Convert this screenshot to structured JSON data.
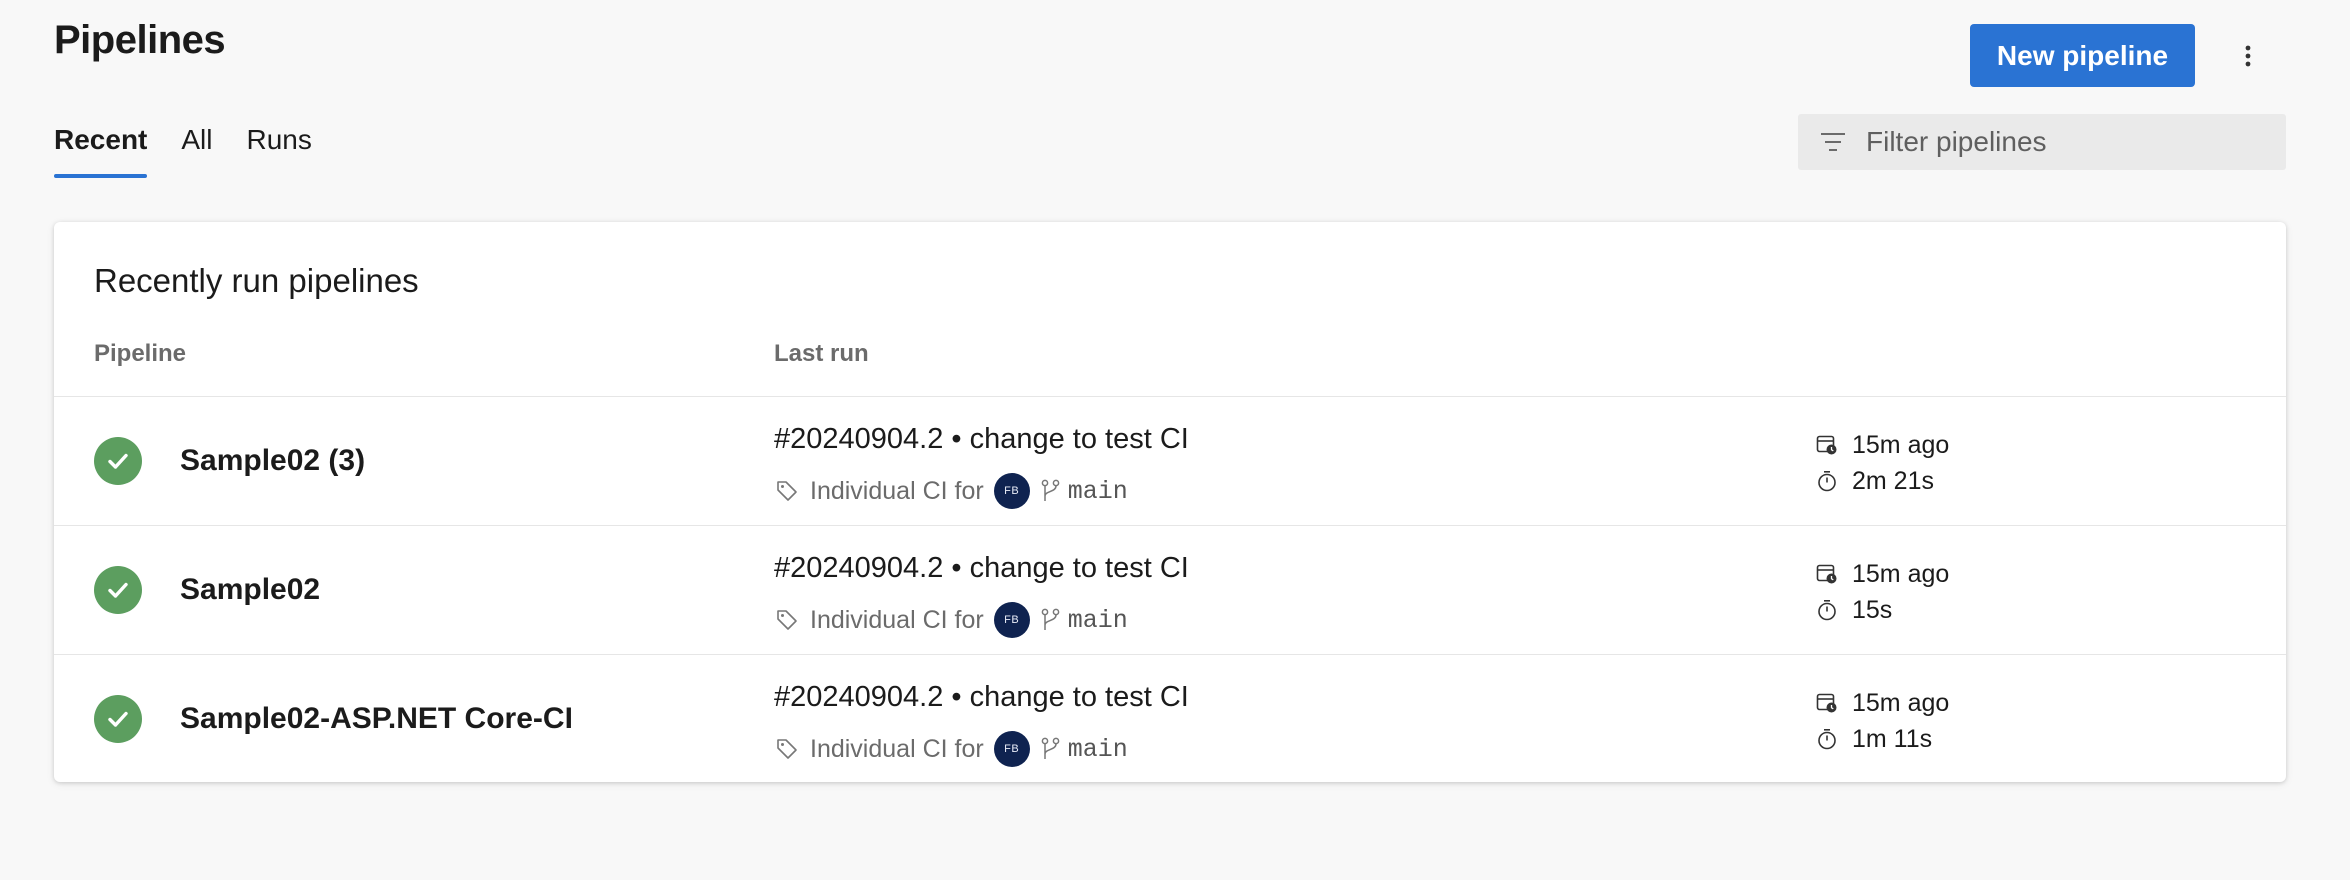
{
  "header": {
    "title": "Pipelines",
    "new_button": "New pipeline",
    "more_icon": "more-vertical-icon"
  },
  "tabs": [
    {
      "label": "Recent",
      "active": true
    },
    {
      "label": "All",
      "active": false
    },
    {
      "label": "Runs",
      "active": false
    }
  ],
  "filter": {
    "placeholder": "Filter pipelines",
    "value": "",
    "icon": "filter-icon"
  },
  "card": {
    "title": "Recently run pipelines",
    "columns": {
      "pipeline": "Pipeline",
      "last_run": "Last run"
    }
  },
  "rows": [
    {
      "name": "Sample02 (3)",
      "status": "succeeded",
      "status_color": "#5c9e5f",
      "run_title": "#20240904.2 • change to test CI",
      "trigger": "Individual CI for",
      "avatar_initials": "FB",
      "branch": "main",
      "started": "15m ago",
      "duration": "2m 21s"
    },
    {
      "name": "Sample02",
      "status": "succeeded",
      "status_color": "#5c9e5f",
      "run_title": "#20240904.2 • change to test CI",
      "trigger": "Individual CI for",
      "avatar_initials": "FB",
      "branch": "main",
      "started": "15m ago",
      "duration": "15s"
    },
    {
      "name": "Sample02-ASP.NET Core-CI",
      "status": "succeeded",
      "status_color": "#5c9e5f",
      "run_title": "#20240904.2 • change to test CI",
      "trigger": "Individual CI for",
      "avatar_initials": "FB",
      "branch": "main",
      "started": "15m ago",
      "duration": "1m 11s"
    }
  ],
  "colors": {
    "accent": "#2a73d3",
    "success": "#5c9e5f",
    "avatar": "#0f2350"
  }
}
